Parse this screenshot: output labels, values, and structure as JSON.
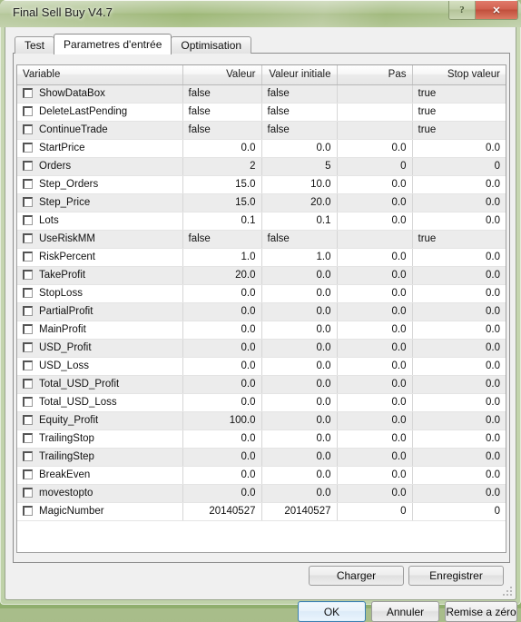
{
  "window": {
    "title": "Final Sell Buy V4.7",
    "help_label": "?",
    "close_label": "✕"
  },
  "tabs": [
    {
      "label": "Test",
      "active": false
    },
    {
      "label": "Parametres d'entrée",
      "active": true
    },
    {
      "label": "Optimisation",
      "active": false
    }
  ],
  "grid": {
    "headers": [
      "Variable",
      "Valeur",
      "Valeur initiale",
      "Pas",
      "Stop valeur"
    ],
    "rows": [
      {
        "name": "ShowDataBox",
        "checked": false,
        "valeur": "false",
        "initiale": "false",
        "pas": "",
        "stop": "true",
        "type": "bool"
      },
      {
        "name": "DeleteLastPending",
        "checked": false,
        "valeur": "false",
        "initiale": "false",
        "pas": "",
        "stop": "true",
        "type": "bool"
      },
      {
        "name": "ContinueTrade",
        "checked": false,
        "valeur": "false",
        "initiale": "false",
        "pas": "",
        "stop": "true",
        "type": "bool"
      },
      {
        "name": "StartPrice",
        "checked": false,
        "valeur": "0.0",
        "initiale": "0.0",
        "pas": "0.0",
        "stop": "0.0",
        "type": "num"
      },
      {
        "name": "Orders",
        "checked": false,
        "valeur": "2",
        "initiale": "5",
        "pas": "0",
        "stop": "0",
        "type": "num"
      },
      {
        "name": "Step_Orders",
        "checked": false,
        "valeur": "15.0",
        "initiale": "10.0",
        "pas": "0.0",
        "stop": "0.0",
        "type": "num"
      },
      {
        "name": "Step_Price",
        "checked": false,
        "valeur": "15.0",
        "initiale": "20.0",
        "pas": "0.0",
        "stop": "0.0",
        "type": "num"
      },
      {
        "name": "Lots",
        "checked": false,
        "valeur": "0.1",
        "initiale": "0.1",
        "pas": "0.0",
        "stop": "0.0",
        "type": "num"
      },
      {
        "name": "UseRiskMM",
        "checked": false,
        "valeur": "false",
        "initiale": "false",
        "pas": "",
        "stop": "true",
        "type": "bool"
      },
      {
        "name": "RiskPercent",
        "checked": false,
        "valeur": "1.0",
        "initiale": "1.0",
        "pas": "0.0",
        "stop": "0.0",
        "type": "num"
      },
      {
        "name": "TakeProfit",
        "checked": false,
        "valeur": "20.0",
        "initiale": "0.0",
        "pas": "0.0",
        "stop": "0.0",
        "type": "num"
      },
      {
        "name": "StopLoss",
        "checked": false,
        "valeur": "0.0",
        "initiale": "0.0",
        "pas": "0.0",
        "stop": "0.0",
        "type": "num"
      },
      {
        "name": "PartialProfit",
        "checked": false,
        "valeur": "0.0",
        "initiale": "0.0",
        "pas": "0.0",
        "stop": "0.0",
        "type": "num"
      },
      {
        "name": "MainProfit",
        "checked": false,
        "valeur": "0.0",
        "initiale": "0.0",
        "pas": "0.0",
        "stop": "0.0",
        "type": "num"
      },
      {
        "name": "USD_Profit",
        "checked": false,
        "valeur": "0.0",
        "initiale": "0.0",
        "pas": "0.0",
        "stop": "0.0",
        "type": "num"
      },
      {
        "name": "USD_Loss",
        "checked": false,
        "valeur": "0.0",
        "initiale": "0.0",
        "pas": "0.0",
        "stop": "0.0",
        "type": "num"
      },
      {
        "name": "Total_USD_Profit",
        "checked": false,
        "valeur": "0.0",
        "initiale": "0.0",
        "pas": "0.0",
        "stop": "0.0",
        "type": "num"
      },
      {
        "name": "Total_USD_Loss",
        "checked": false,
        "valeur": "0.0",
        "initiale": "0.0",
        "pas": "0.0",
        "stop": "0.0",
        "type": "num"
      },
      {
        "name": "Equity_Profit",
        "checked": false,
        "valeur": "100.0",
        "initiale": "0.0",
        "pas": "0.0",
        "stop": "0.0",
        "type": "num"
      },
      {
        "name": "TrailingStop",
        "checked": false,
        "valeur": "0.0",
        "initiale": "0.0",
        "pas": "0.0",
        "stop": "0.0",
        "type": "num"
      },
      {
        "name": "TrailingStep",
        "checked": false,
        "valeur": "0.0",
        "initiale": "0.0",
        "pas": "0.0",
        "stop": "0.0",
        "type": "num"
      },
      {
        "name": "BreakEven",
        "checked": false,
        "valeur": "0.0",
        "initiale": "0.0",
        "pas": "0.0",
        "stop": "0.0",
        "type": "num"
      },
      {
        "name": "movestopto",
        "checked": false,
        "valeur": "0.0",
        "initiale": "0.0",
        "pas": "0.0",
        "stop": "0.0",
        "type": "num"
      },
      {
        "name": "MagicNumber",
        "checked": false,
        "valeur": "20140527",
        "initiale": "20140527",
        "pas": "0",
        "stop": "0",
        "type": "num"
      }
    ]
  },
  "panel_buttons": {
    "charger": "Charger",
    "enregistrer": "Enregistrer"
  },
  "dialog_buttons": {
    "ok": "OK",
    "annuler": "Annuler",
    "reset": "Remise a zéro"
  }
}
